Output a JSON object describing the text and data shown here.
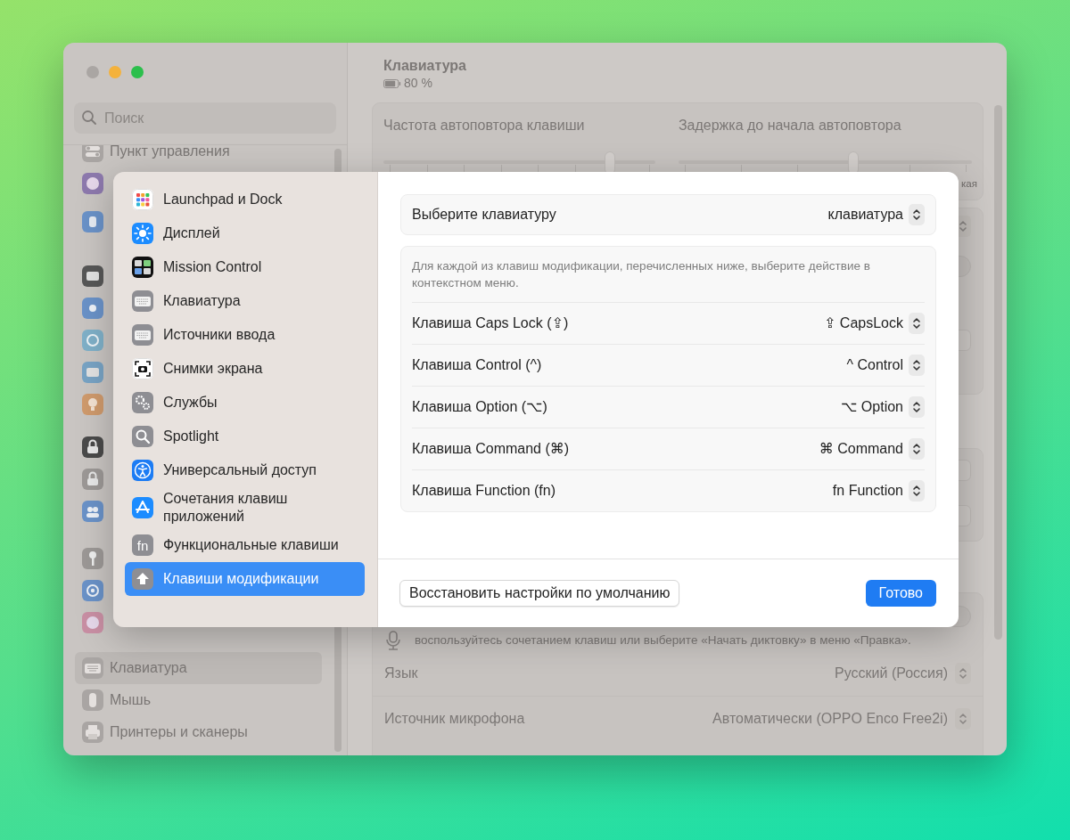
{
  "window": {
    "sidebar": {
      "search": {
        "placeholder": "Поиск"
      },
      "items_above": [
        {
          "label": "Пункт управления",
          "selected": false
        }
      ],
      "items_below": [
        {
          "label": "Клавиатура",
          "selected": true
        },
        {
          "label": "Мышь",
          "selected": false
        },
        {
          "label": "Принтеры и сканеры",
          "selected": false
        }
      ]
    },
    "header": {
      "title": "Клавиатура",
      "battery": "80 %"
    },
    "sliders": [
      {
        "label": "Частота автоповтора клавиши",
        "level": 0.85
      },
      {
        "label": "Задержка до начала автоповтора",
        "level": 0.6,
        "end_label": "кая"
      }
    ],
    "switches": [
      {
        "on": false
      },
      {
        "on": false
      }
    ],
    "dictation_note": "воспользуйтесь сочетанием клавиш или выберите «Начать диктовку» в меню «Правка».",
    "settings": [
      {
        "label": "Язык",
        "value": "Русский (Россия)"
      },
      {
        "label": "Источник микрофона",
        "value": "Автоматически (OPPO Enco Free2i)"
      }
    ]
  },
  "sheet": {
    "sidebar": [
      {
        "label": "Launchpad и Dock",
        "selected": false
      },
      {
        "label": "Дисплей",
        "selected": false
      },
      {
        "label": "Mission Control",
        "selected": false
      },
      {
        "label": "Клавиатура",
        "selected": false
      },
      {
        "label": "Источники ввода",
        "selected": false
      },
      {
        "label": "Снимки экрана",
        "selected": false
      },
      {
        "label": "Службы",
        "selected": false
      },
      {
        "label": "Spotlight",
        "selected": false
      },
      {
        "label": "Универсальный доступ",
        "selected": false
      },
      {
        "label": "Сочетания клавиш приложений",
        "selected": false
      },
      {
        "label": "Функциональные клавиши",
        "selected": false,
        "icon_text": "fn"
      },
      {
        "label": "Клавиши модификации",
        "selected": true
      }
    ],
    "keyboard_select": {
      "label": "Выберите клавиатуру",
      "value": "клавиатура"
    },
    "note": "Для каждой из клавиш модификации, перечисленных ниже, выберите действие в контекстном меню.",
    "modifiers": [
      {
        "label": "Клавиша Caps Lock (⇪)",
        "value": "⇪ CapsLock"
      },
      {
        "label": "Клавиша Control (^)",
        "value": "^ Control"
      },
      {
        "label": "Клавиша Option (⌥)",
        "value": "⌥ Option"
      },
      {
        "label": "Клавиша Command (⌘)",
        "value": "⌘ Command"
      },
      {
        "label": "Клавиша Function (fn)",
        "value": "fn Function"
      }
    ],
    "buttons": {
      "reset": "Восстановить настройки по умолчанию",
      "done": "Готово"
    }
  }
}
